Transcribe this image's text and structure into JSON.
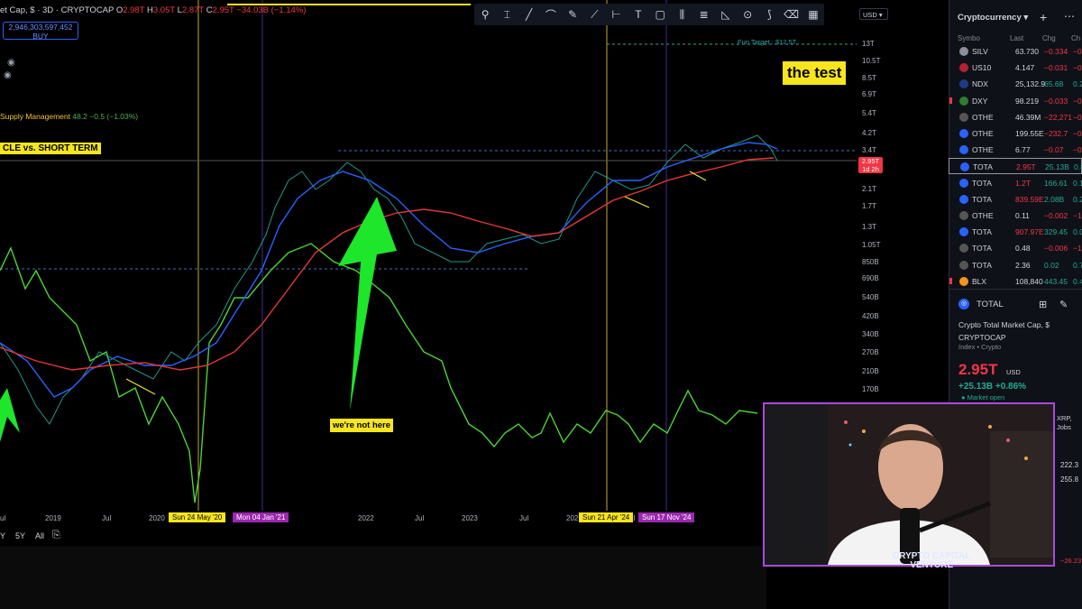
{
  "header": {
    "symbol": "et Cap, $ · 3D · CRYPTOCAP",
    "o_label": "O",
    "o": "2.98T",
    "h_label": "H",
    "h": "3.05T",
    "l_label": "L",
    "l": "2.87T",
    "c_label": "C",
    "c": "2.95T",
    "change": "−34.03B (−1.14%)"
  },
  "buy_box": {
    "value": "2,946,303,597,452",
    "label": "BUY"
  },
  "indicator": {
    "name": "Supply Management",
    "value": "48.2",
    "change": "−0.5 (−1.03%)"
  },
  "annotations": {
    "cycle": "CLE vs. SHORT TERM",
    "test": "the test",
    "not_here": "we're not here",
    "fun_target": "Fun Target : $12.5T"
  },
  "toolbar": {
    "icons": [
      "settings-sliders-icon",
      "crosshair-icon",
      "trend-line-icon",
      "brush-icon",
      "pencil-icon",
      "ray-icon",
      "ruler-icon",
      "text-icon",
      "rectangle-icon",
      "bars-icon",
      "fib-icon",
      "triangle-icon",
      "circle-icon",
      "eyedropper-icon",
      "eraser-icon",
      "grid-icon"
    ],
    "glyphs": [
      "⚲",
      "⌶",
      "╱",
      "⌒",
      "✎",
      "⟋",
      "⊢",
      "T",
      "▢",
      "⫼",
      "≣",
      "◺",
      "⊙",
      "⟆",
      "⌫",
      "▦"
    ]
  },
  "currency": "USD",
  "price_axis": [
    "13T",
    "10.5T",
    "8.5T",
    "6.9T",
    "5.4T",
    "4.2T",
    "3.4T",
    "2.1T",
    "1.7T",
    "1.3T",
    "1.05T",
    "850B",
    "690B",
    "540B",
    "420B",
    "340B",
    "270B",
    "210B",
    "170B"
  ],
  "price_tag": {
    "price": "2.95T",
    "countdown": "1d 2h"
  },
  "time_axis": [
    "ul",
    "2019",
    "Jul",
    "2020",
    "Jul",
    "2022",
    "Jul",
    "2023",
    "Jul",
    "202",
    "Jul"
  ],
  "time_marks": [
    {
      "label": "Sun 24 May '20",
      "color": "yellow"
    },
    {
      "label": "Mon 04 Jan '21",
      "color": "purple"
    },
    {
      "label": "Sun 21 Apr '24",
      "color": "yellow"
    },
    {
      "label": "Sun 17 Nov '24",
      "color": "purple"
    }
  ],
  "ranges": [
    "Y",
    "5Y",
    "All"
  ],
  "watchlist": {
    "title": "Cryptocurrency",
    "columns": {
      "symbol": "Symbo",
      "last": "Last",
      "chg": "Chg",
      "chgp": "Ch"
    },
    "rows": [
      {
        "sym": "SILV",
        "last": "63.730",
        "chg": "−0.334",
        "chgp": "−0.5",
        "dot": "#8a8f99",
        "neg": true
      },
      {
        "sym": "US10",
        "last": "4.147",
        "chg": "−0.031",
        "chgp": "−0.7",
        "dot": "#b22234",
        "neg": true
      },
      {
        "sym": "NDX",
        "last": "25,132.9",
        "chg": "65.68",
        "chgp": "0.2",
        "dot": "#1e3a8a",
        "neg": false
      },
      {
        "sym": "DXY",
        "last": "98.219",
        "chg": "−0.033",
        "chgp": "−0.0",
        "dot": "#2e7d32",
        "neg": true
      },
      {
        "sym": "OTHE",
        "last": "46.39M",
        "chg": "−22,271",
        "chgp": "−0.0",
        "dot": "#555",
        "neg": true
      },
      {
        "sym": "OTHE",
        "last": "199.55E",
        "chg": "−232.7",
        "chgp": "−0.1",
        "dot": "#2962ff",
        "neg": true
      },
      {
        "sym": "OTHE",
        "last": "6.77",
        "chg": "−0.07",
        "chgp": "−0.9",
        "dot": "#2962ff",
        "neg": true
      },
      {
        "sym": "TOTA",
        "last": "2.95T",
        "chg": "25.13B",
        "chgp": "0.8",
        "dot": "#2962ff",
        "neg": false,
        "last_red": true
      },
      {
        "sym": "TOTA",
        "last": "1.2T",
        "chg": "166.61",
        "chgp": "0.1",
        "dot": "#2962ff",
        "neg": false,
        "last_red": true
      },
      {
        "sym": "TOTA",
        "last": "839.59E",
        "chg": "2.08B",
        "chgp": "0.2",
        "dot": "#2962ff",
        "neg": false,
        "last_red": true
      },
      {
        "sym": "OTHE",
        "last": "0.11",
        "chg": "−0.002",
        "chgp": "−1.5",
        "dot": "#555",
        "neg": true
      },
      {
        "sym": "TOTA",
        "last": "907.97E",
        "chg": "329.45",
        "chgp": "0.0",
        "dot": "#2962ff",
        "neg": false,
        "last_red": true
      },
      {
        "sym": "TOTA",
        "last": "0.48",
        "chg": "−0.006",
        "chgp": "−1.1",
        "dot": "#555",
        "neg": true
      },
      {
        "sym": "TOTA",
        "last": "2.36",
        "chg": "0.02",
        "chgp": "0.7",
        "dot": "#555",
        "neg": false
      },
      {
        "sym": "BLX",
        "last": "108,840",
        "chg": "443.45",
        "chgp": "0.4",
        "dot": "#f7931a",
        "neg": false
      }
    ]
  },
  "detail": {
    "symbol": "TOTAL",
    "name": "Crypto Total Market Cap, $",
    "exchange": "CRYPTOCAP",
    "type": "Index • Crypto",
    "price": "2.95T",
    "currency": "USD",
    "change": "+25.13B +0.86%",
    "status": "Market open"
  },
  "webcam": {
    "brand_line1": "CRYPTO CAPITAL",
    "brand_line2": "VENTURE"
  },
  "side_fragments": {
    "xrp": "XRP,",
    "jobs": "Jobs",
    "v1": "222.3",
    "v2": "255.8",
    "red": "−26.23"
  }
}
